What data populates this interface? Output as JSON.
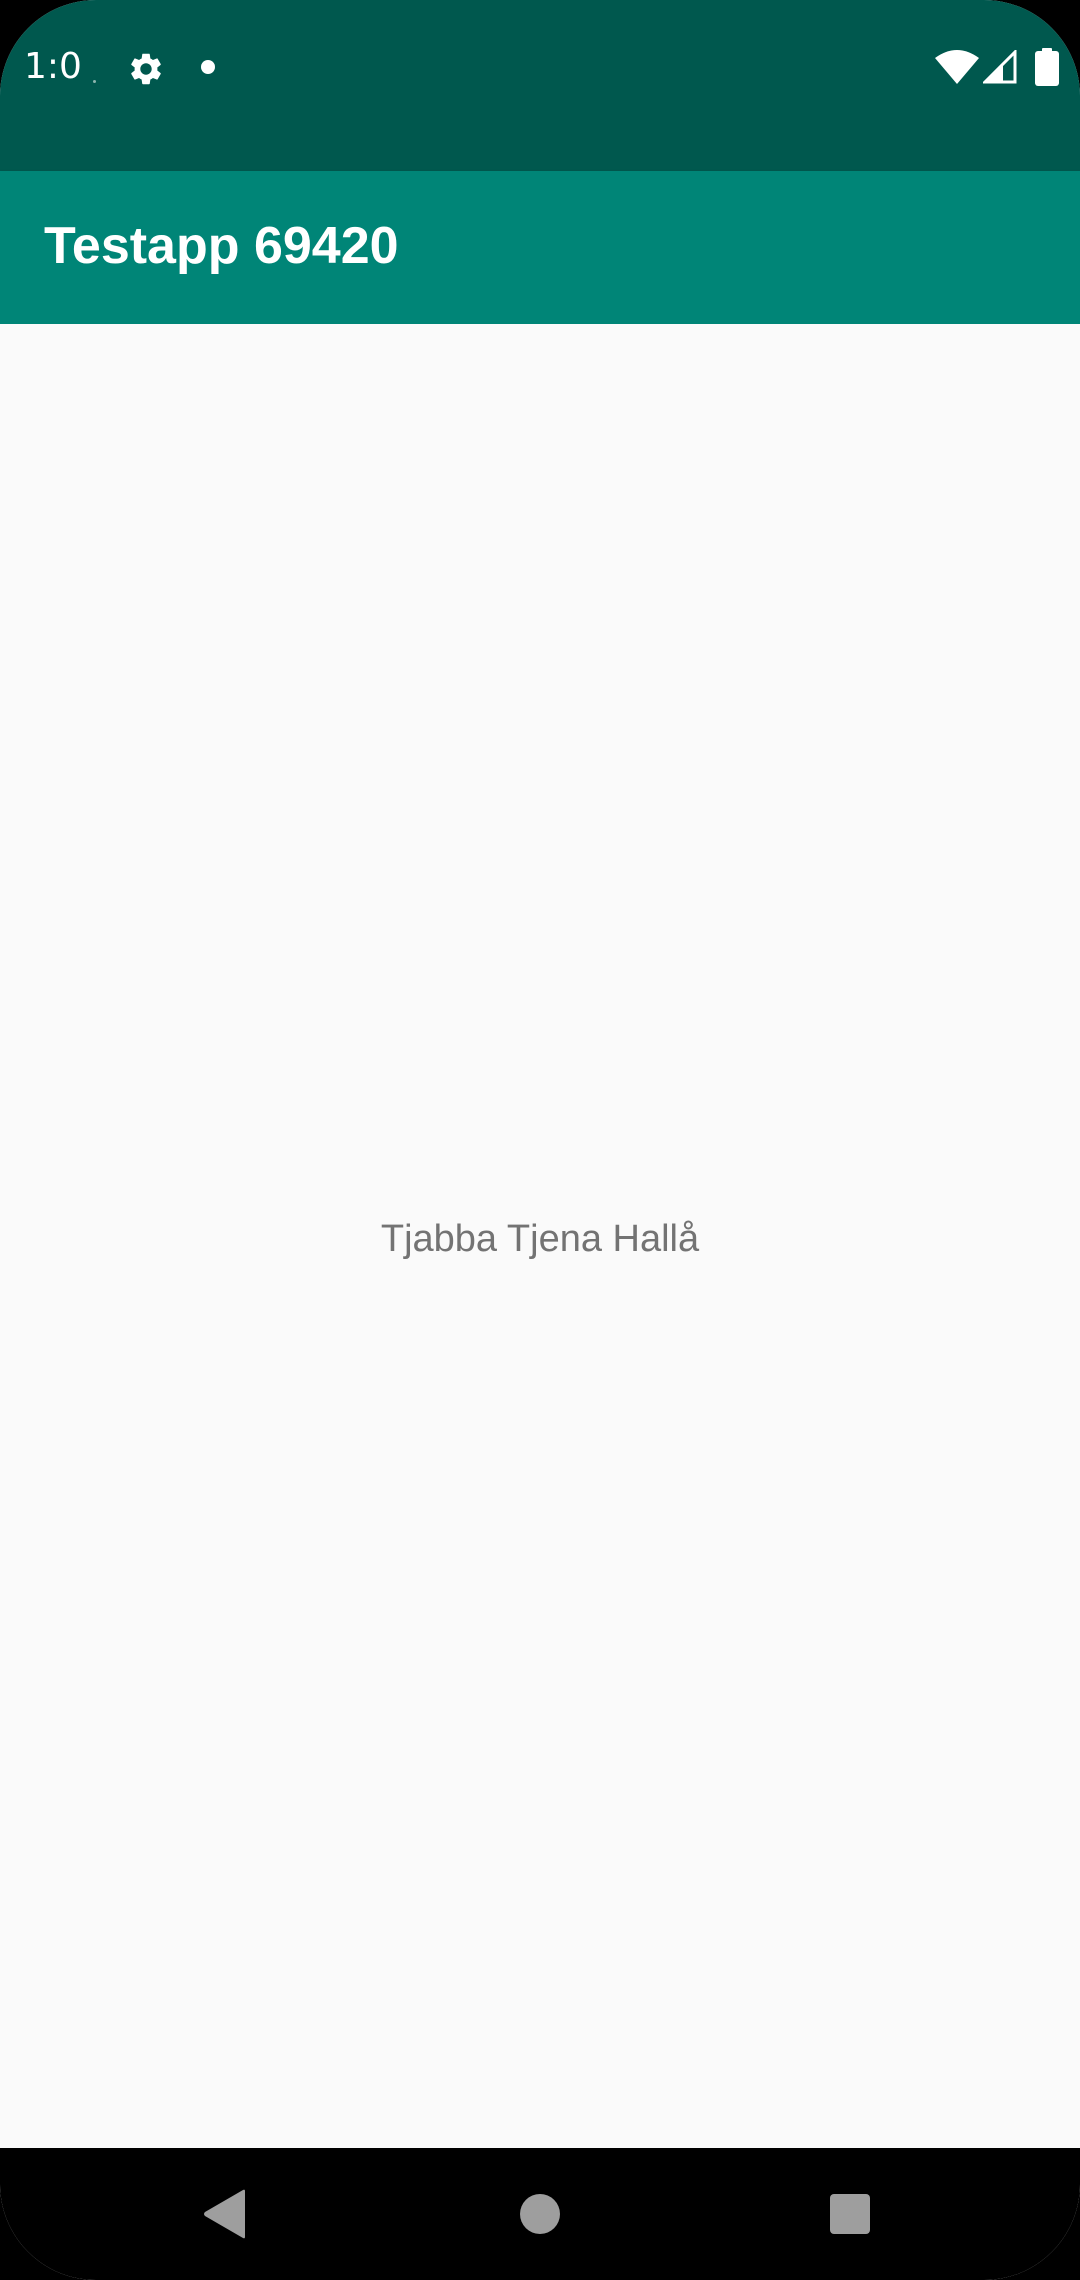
{
  "status_bar": {
    "time": "1:0",
    "icons": [
      "gear-icon",
      "notification-dot",
      "wifi-icon",
      "cell-signal-icon",
      "battery-icon"
    ],
    "background": "#00584E"
  },
  "app_bar": {
    "title": "Testapp 69420",
    "background": "#008577"
  },
  "main": {
    "message": "Tjabba Tjena Hallå",
    "background": "#FAFAFA",
    "text_color": "#737373"
  },
  "nav_bar": {
    "buttons": [
      "back-button",
      "home-button",
      "recents-button"
    ],
    "background": "#000000",
    "icon_color": "#9E9E9E"
  }
}
